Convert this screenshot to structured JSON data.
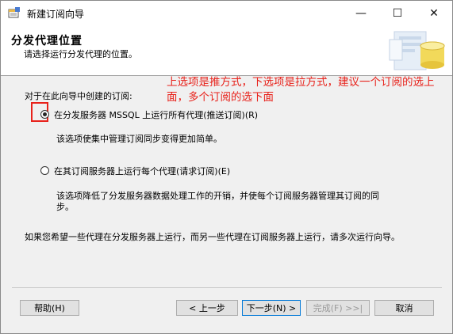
{
  "window": {
    "title": "新建订阅向导",
    "controls": {
      "minimize": "—",
      "maximize": "☐",
      "close": "✕"
    }
  },
  "header": {
    "title": "分发代理位置",
    "subtitle": "请选择运行分发代理的位置。",
    "graphic": "database-wizard-graphic"
  },
  "content": {
    "prompt": "对于在此向导中创建的订阅:",
    "annotation": "上选项是推方式，下选项是拉方式，建议一个订阅的选上面，多个订阅的选下面",
    "options": [
      {
        "label": "在分发服务器 MSSQL 上运行所有代理(推送订阅)(R)",
        "selected": true,
        "description": "该选项使集中管理订阅同步变得更加简单。"
      },
      {
        "label": "在其订阅服务器上运行每个代理(请求订阅)(E)",
        "selected": false,
        "description": "该选项降低了分发服务器数据处理工作的开销，并使每个订阅服务器管理其订阅的同步。"
      }
    ],
    "note": "如果您希望一些代理在分发服务器上运行，而另一些代理在订阅服务器上运行，请多次运行向导。"
  },
  "buttons": {
    "help": "帮助(H)",
    "back": "< 上一步",
    "next": "下一步(N) >",
    "finish": "完成(F) >>|",
    "cancel": "取消"
  },
  "colors": {
    "annotation": "#e8221b",
    "default_button_border": "#0078d7",
    "background": "#f0f0f0"
  }
}
